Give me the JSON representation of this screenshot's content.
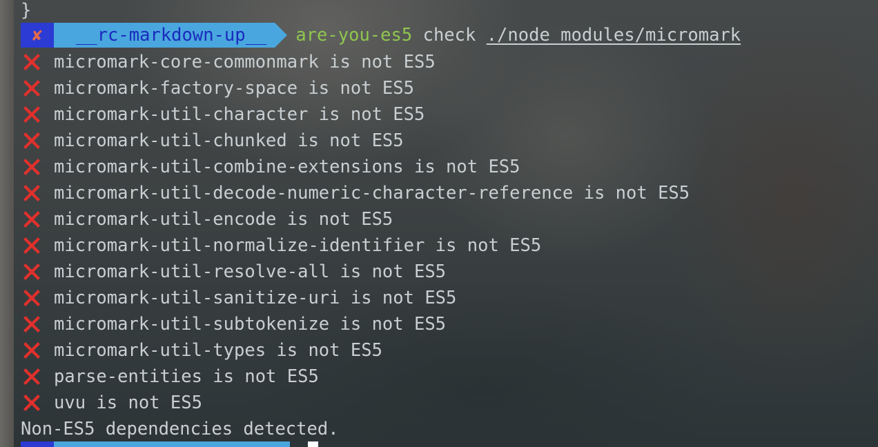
{
  "terminal": {
    "brace_line": "}",
    "prompt": {
      "status_symbol": "✘",
      "directory": "__rc-markdown-up__",
      "command_bin": "are-you-es5",
      "command_args": " check ",
      "command_path": "./node_modules/micromark"
    },
    "errors": [
      "micromark-core-commonmark is not ES5",
      "micromark-factory-space is not ES5",
      "micromark-util-character is not ES5",
      "micromark-util-chunked is not ES5",
      "micromark-util-combine-extensions is not ES5",
      "micromark-util-decode-numeric-character-reference is not ES5",
      "micromark-util-encode is not ES5",
      "micromark-util-normalize-identifier is not ES5",
      "micromark-util-resolve-all is not ES5",
      "micromark-util-sanitize-uri is not ES5",
      "micromark-util-subtokenize is not ES5",
      "micromark-util-types is not ES5",
      "parse-entities is not ES5",
      "uvu is not ES5"
    ],
    "summary": "Non-ES5 dependencies detected.",
    "error_icon": "cross-mark-icon",
    "colors": {
      "status_segment": "#2b3bd3",
      "dir_segment": "#4aa6de",
      "command_bin": "#8fc64f",
      "error_icon": "#e0302c"
    }
  }
}
